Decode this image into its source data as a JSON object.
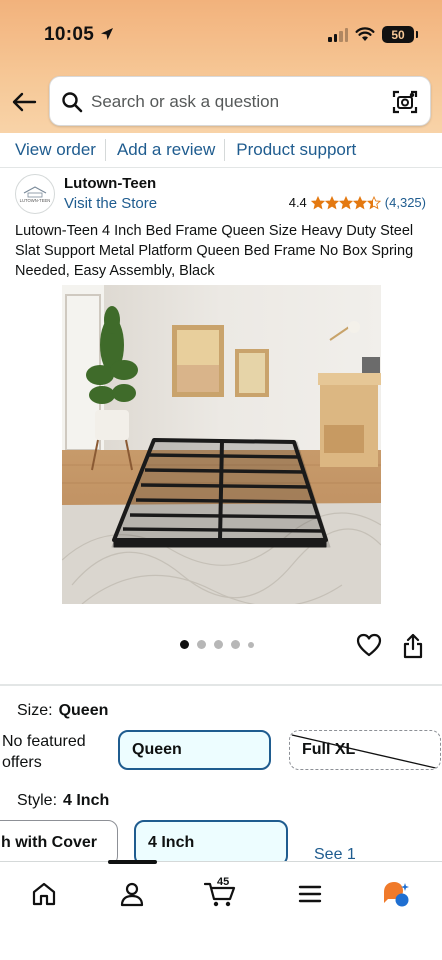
{
  "status_bar": {
    "time": "10:05",
    "battery": "50"
  },
  "search": {
    "placeholder": "Search or ask a question"
  },
  "order_links": [
    "View order",
    "Add a review",
    "Product support"
  ],
  "seller": {
    "brand": "Lutown-Teen",
    "store_link": "Visit the Store",
    "logo_text": "LUTOWN-TEEN"
  },
  "rating": {
    "value": "4.4",
    "stars": 4.4,
    "count": "(4,325)"
  },
  "product": {
    "title": "Lutown-Teen 4 Inch Bed Frame Queen Size Heavy Duty Steel Slat Support Metal Platform Queen Bed Frame No Box Spring Needed, Easy Assembly, Black",
    "image_count": 5,
    "active_image": 0
  },
  "size": {
    "label": "Size:",
    "selected": "Queen",
    "no_featured_offers": "No featured offers",
    "options": [
      "Queen",
      "Full XL"
    ]
  },
  "style": {
    "label": "Style:",
    "selected": "4 Inch",
    "options": [
      "h with Cover",
      "4 Inch"
    ],
    "see_more": "See 1"
  },
  "tabbar": {
    "cart_count": "45"
  },
  "colors": {
    "link": "#1f5c8f",
    "star": "#e47911",
    "selected_border": "#1f5c8f",
    "header_bg": "#f4bd88"
  }
}
